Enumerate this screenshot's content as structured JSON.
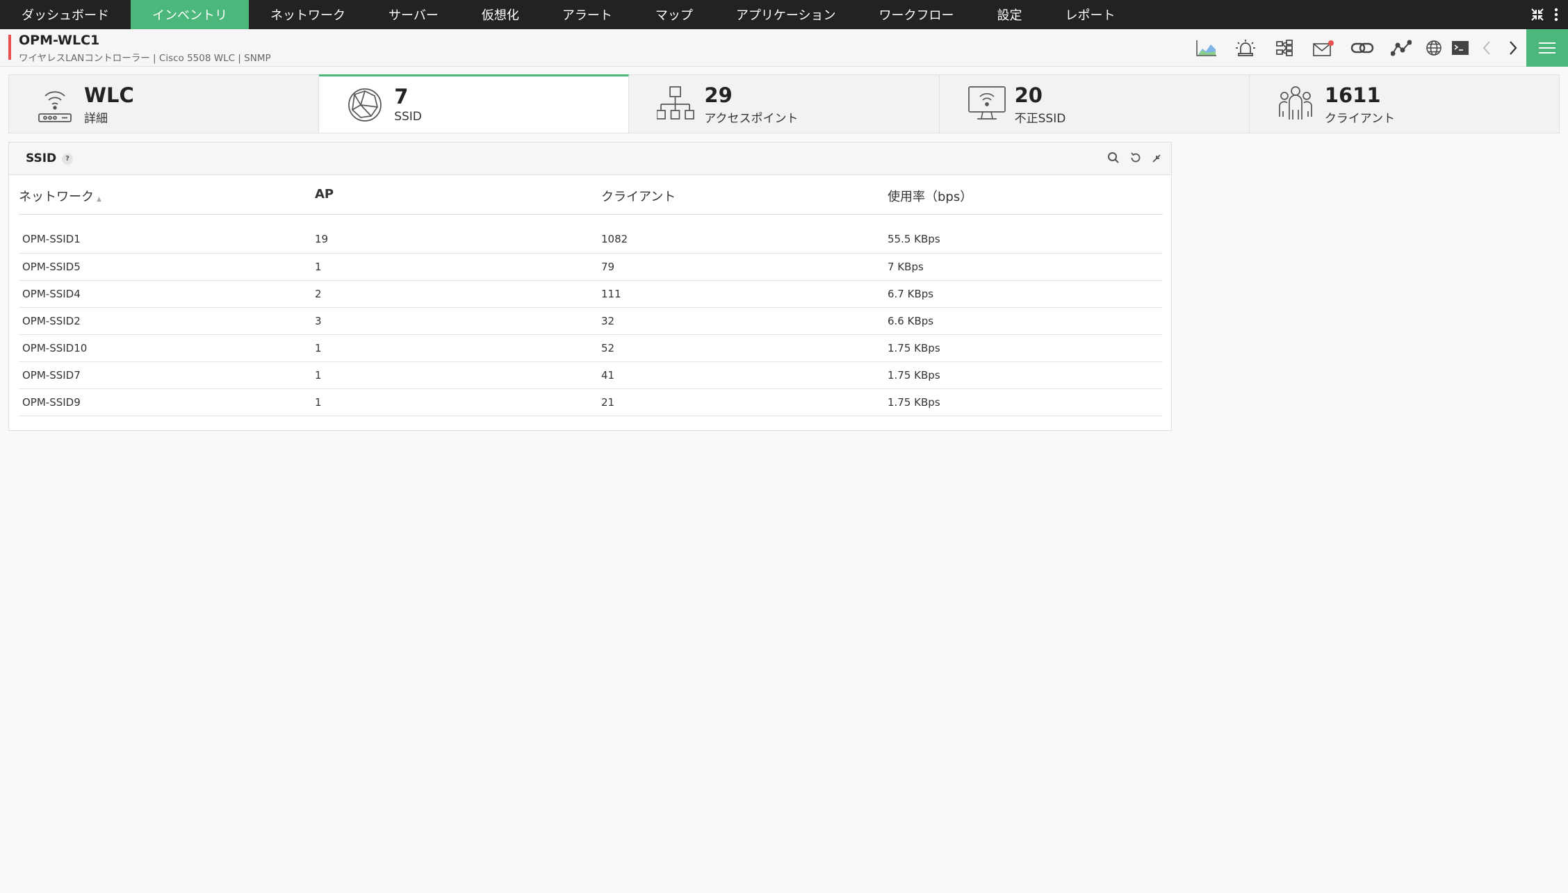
{
  "nav": {
    "items": [
      "ダッシュボード",
      "インベントリ",
      "ネットワーク",
      "サーバー",
      "仮想化",
      "アラート",
      "マップ",
      "アプリケーション",
      "ワークフロー",
      "設定",
      "レポート"
    ],
    "active_index": 1,
    "active_color": "#4cb77b"
  },
  "device": {
    "name": "OPM-WLC1",
    "subtitle": "ワイヤレスLANコントローラー | Cisco 5508 WLC | SNMP"
  },
  "toolbar_icons": [
    "chart-icon",
    "alarm-icon",
    "network-icon",
    "mail-icon",
    "link-icon",
    "graph-icon",
    "globe-icon",
    "terminal-icon",
    "prev-icon",
    "next-icon",
    "menu-icon"
  ],
  "tiles": [
    {
      "value": "WLC",
      "label": "詳細",
      "icon": "router-icon"
    },
    {
      "value": "7",
      "label": "SSID",
      "icon": "globe-network-icon"
    },
    {
      "value": "29",
      "label": "アクセスポイント",
      "icon": "hierarchy-icon"
    },
    {
      "value": "20",
      "label": "不正SSID",
      "icon": "monitor-wifi-icon"
    },
    {
      "value": "1611",
      "label": "クライアント",
      "icon": "users-icon"
    }
  ],
  "active_tile_index": 1,
  "panel": {
    "title": "SSID",
    "help": "?",
    "columns": {
      "network": "ネットワーク",
      "ap": "AP",
      "clients": "クライアント",
      "usage": "使用率（bps）"
    },
    "rows": [
      {
        "network": "OPM-SSID1",
        "ap": "19",
        "clients": "1082",
        "usage": "55.5 KBps"
      },
      {
        "network": "OPM-SSID5",
        "ap": "1",
        "clients": "79",
        "usage": "7 KBps"
      },
      {
        "network": "OPM-SSID4",
        "ap": "2",
        "clients": "111",
        "usage": "6.7 KBps"
      },
      {
        "network": "OPM-SSID2",
        "ap": "3",
        "clients": "32",
        "usage": "6.6 KBps"
      },
      {
        "network": "OPM-SSID10",
        "ap": "1",
        "clients": "52",
        "usage": "1.75 KBps"
      },
      {
        "network": "OPM-SSID7",
        "ap": "1",
        "clients": "41",
        "usage": "1.75 KBps"
      },
      {
        "network": "OPM-SSID9",
        "ap": "1",
        "clients": "21",
        "usage": "1.75 KBps"
      }
    ]
  }
}
